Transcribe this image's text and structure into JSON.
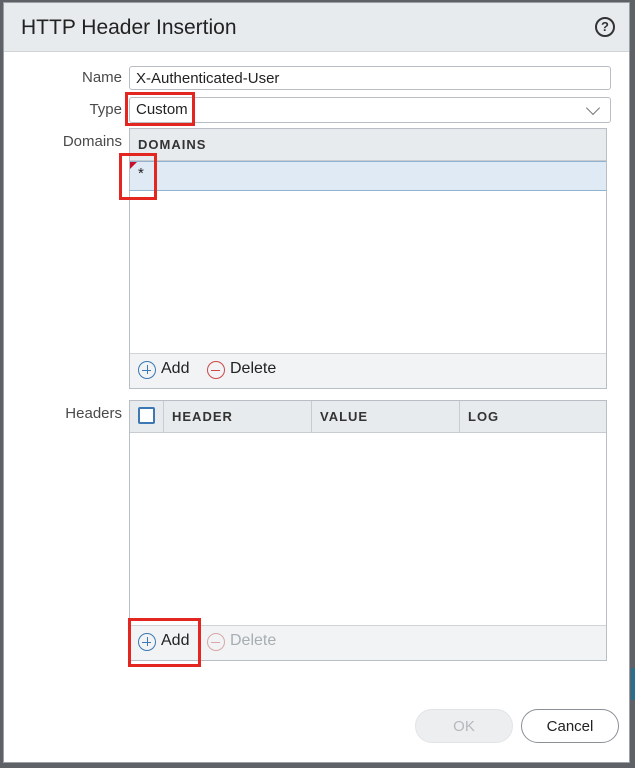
{
  "dialog": {
    "title": "HTTP Header Insertion",
    "help_icon": "?"
  },
  "form": {
    "name_label": "Name",
    "name_value": "X-Authenticated-User",
    "type_label": "Type",
    "type_value": "Custom",
    "domains_label": "Domains",
    "headers_label": "Headers"
  },
  "domains_grid": {
    "columns": [
      "DOMAINS"
    ],
    "rows": [
      "*"
    ],
    "add_label": "Add",
    "delete_label": "Delete"
  },
  "headers_grid": {
    "columns": [
      "HEADER",
      "VALUE",
      "LOG"
    ],
    "rows": [],
    "add_label": "Add",
    "delete_label": "Delete"
  },
  "buttons": {
    "ok": "OK",
    "cancel": "Cancel"
  },
  "colors": {
    "highlight_box": "#e3261f",
    "accent": "#3b78b4",
    "error_flag": "#c8102e"
  }
}
